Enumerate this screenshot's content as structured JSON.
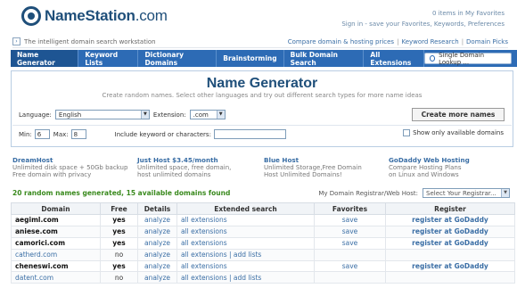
{
  "brand": {
    "name": "NameStation",
    "dotcom": ".com"
  },
  "top_links": {
    "favorites": "0 items in My Favorites",
    "signin": "Sign in - save your Favorites, Keywords, Preferences"
  },
  "tagline": "The intelligent domain search workstation",
  "tag_links": [
    "Compare domain & hosting prices",
    "Keyword Research",
    "Domain Picks"
  ],
  "nav": {
    "tabs": [
      "Name Generator",
      "Keyword Lists",
      "Dictionary Domains",
      "Brainstorming",
      "Bulk Domain Search",
      "All Extensions"
    ],
    "lookup_label": "Single Domain Lookup ..."
  },
  "generator": {
    "title": "Name Generator",
    "subtitle": "Create random names. Select other languages and try out different search types for more name ideas",
    "language_label": "Language:",
    "language_value": "English",
    "extension_label": "Extension:",
    "extension_value": ".com",
    "button": "Create more names",
    "min_label": "Min:",
    "min_value": "6",
    "max_label": "Max:",
    "max_value": "8",
    "include_label": "Include keyword or characters:",
    "include_value": "",
    "show_only_label": "Show only available domains"
  },
  "ads": [
    {
      "title": "DreamHost",
      "lines": [
        "Unlimited disk space + 50Gb backup",
        "Free domain with privacy"
      ]
    },
    {
      "title": "Just Host $3.45/month",
      "lines": [
        "Unlimited space, free domain,",
        "host unlimited domains"
      ]
    },
    {
      "title": "Blue Host",
      "lines": [
        "Unlimited Storage,Free Domain",
        "Host Unlimited Domains!"
      ]
    },
    {
      "title": "GoDaddy Web Hosting",
      "lines": [
        "Compare Hosting Plans",
        "on Linux and Windows"
      ]
    }
  ],
  "results_summary": "20 random names generated, 15 available domains found",
  "registrar": {
    "label": "My Domain Registrar/Web Host:",
    "value": "Select Your Registrar..."
  },
  "table": {
    "headers": [
      "Domain",
      "Free",
      "Details",
      "Extended search",
      "Favorites",
      "Register"
    ],
    "rows": [
      {
        "domain": "aegiml.com",
        "free": "yes",
        "details": "analyze",
        "extended": "all extensions",
        "favorites": "save",
        "register": "register at GoDaddy"
      },
      {
        "domain": "aniese.com",
        "free": "yes",
        "details": "analyze",
        "extended": "all extensions",
        "favorites": "save",
        "register": "register at GoDaddy"
      },
      {
        "domain": "camorici.com",
        "free": "yes",
        "details": "analyze",
        "extended": "all extensions",
        "favorites": "save",
        "register": "register at GoDaddy"
      },
      {
        "domain": "catherd.com",
        "free": "no",
        "details": "analyze",
        "extended": "all extensions | add lists",
        "favorites": "",
        "register": ""
      },
      {
        "domain": "cheneswi.com",
        "free": "yes",
        "details": "analyze",
        "extended": "all extensions",
        "favorites": "save",
        "register": "register at GoDaddy"
      },
      {
        "domain": "datent.com",
        "free": "no",
        "details": "analyze",
        "extended": "all extensions | add lists",
        "favorites": "",
        "register": ""
      }
    ]
  }
}
